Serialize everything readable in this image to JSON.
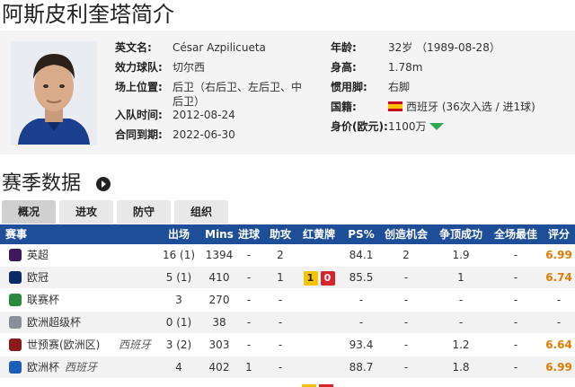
{
  "page": {
    "title": "阿斯皮利奎塔简介"
  },
  "profile": {
    "fields": [
      {
        "label": "英文名:",
        "value": "César Azpilicueta"
      },
      {
        "label": "效力球队:",
        "value": "切尔西"
      },
      {
        "label": "场上位置:",
        "value": "后卫（右后卫、左后卫、中后卫）"
      },
      {
        "label": "入队时间:",
        "value": "2012-08-24"
      },
      {
        "label": "合同到期:",
        "value": "2022-06-30"
      },
      {
        "label": "年龄:",
        "value": "32岁 （1989-08-28）"
      },
      {
        "label": "身高:",
        "value": "1.78m"
      },
      {
        "label": "惯用脚:",
        "value": "右脚"
      },
      {
        "label": "国籍:",
        "value": "西班牙 (36次入选 / 进1球)"
      },
      {
        "label": "身价(欧元):",
        "value": "1100万"
      }
    ],
    "value_trend": "down",
    "colors": {
      "trend": "#2fa84f",
      "flag_red": "#c60b1e",
      "flag_yellow": "#ffc400"
    }
  },
  "season": {
    "title": "赛季数据",
    "more_icon": "arrow-right-circle-icon"
  },
  "tabs": [
    {
      "label": "概况",
      "active": true
    },
    {
      "label": "进攻",
      "active": false
    },
    {
      "label": "防守",
      "active": false
    },
    {
      "label": "组织",
      "active": false
    }
  ],
  "table": {
    "headers": [
      "赛事",
      "出场",
      "Mins",
      "进球",
      "助攻",
      "红黄牌",
      "PS%",
      "创造机会",
      "争顶成功",
      "全场最佳",
      "评分"
    ],
    "rows": [
      {
        "comp": "英超",
        "note": "",
        "icon": "premier-league-icon",
        "icon_color": "#3d195b",
        "apps": "16 (1)",
        "mins": "1394",
        "goals": "-",
        "assists": "2",
        "yellow": "",
        "red": "",
        "ps": "84.1",
        "chances": "2",
        "aerial": "1.9",
        "motm": "-",
        "rating": "6.99"
      },
      {
        "comp": "欧冠",
        "note": "",
        "icon": "champions-league-icon",
        "icon_color": "#0b2b68",
        "apps": "5 (1)",
        "mins": "410",
        "goals": "-",
        "assists": "1",
        "yellow": "1",
        "red": "0",
        "ps": "85.5",
        "chances": "-",
        "aerial": "1",
        "motm": "-",
        "rating": "6.74"
      },
      {
        "comp": "联赛杯",
        "note": "",
        "icon": "league-cup-icon",
        "icon_color": "#2a8a3e",
        "apps": "3",
        "mins": "270",
        "goals": "-",
        "assists": "-",
        "yellow": "",
        "red": "",
        "ps": "-",
        "chances": "-",
        "aerial": "-",
        "motm": "-",
        "rating": "-"
      },
      {
        "comp": "欧洲超级杯",
        "note": "",
        "icon": "super-cup-icon",
        "icon_color": "#8a8f99",
        "apps": "0 (1)",
        "mins": "38",
        "goals": "-",
        "assists": "-",
        "yellow": "",
        "red": "",
        "ps": "-",
        "chances": "-",
        "aerial": "-",
        "motm": "-",
        "rating": "-"
      },
      {
        "comp": "世预赛(欧洲区)",
        "note": "西班牙",
        "icon": "world-cup-qualifier-icon",
        "icon_color": "#8b1a1a",
        "apps": "3 (2)",
        "mins": "303",
        "goals": "-",
        "assists": "-",
        "yellow": "",
        "red": "",
        "ps": "93.4",
        "chances": "-",
        "aerial": "1.2",
        "motm": "-",
        "rating": "6.64"
      },
      {
        "comp": "欧洲杯",
        "note": "西班牙",
        "icon": "euro-cup-icon",
        "icon_color": "#1c5fb8",
        "apps": "4",
        "mins": "402",
        "goals": "1",
        "assists": "-",
        "yellow": "",
        "red": "",
        "ps": "88.7",
        "chances": "-",
        "aerial": "1.8",
        "motm": "-",
        "rating": "6.99"
      }
    ],
    "colors": {
      "header_bg": "#1f4e99",
      "rating": "#e07b00",
      "yellow_card": "#f5c400",
      "red_card": "#d6242a"
    }
  }
}
